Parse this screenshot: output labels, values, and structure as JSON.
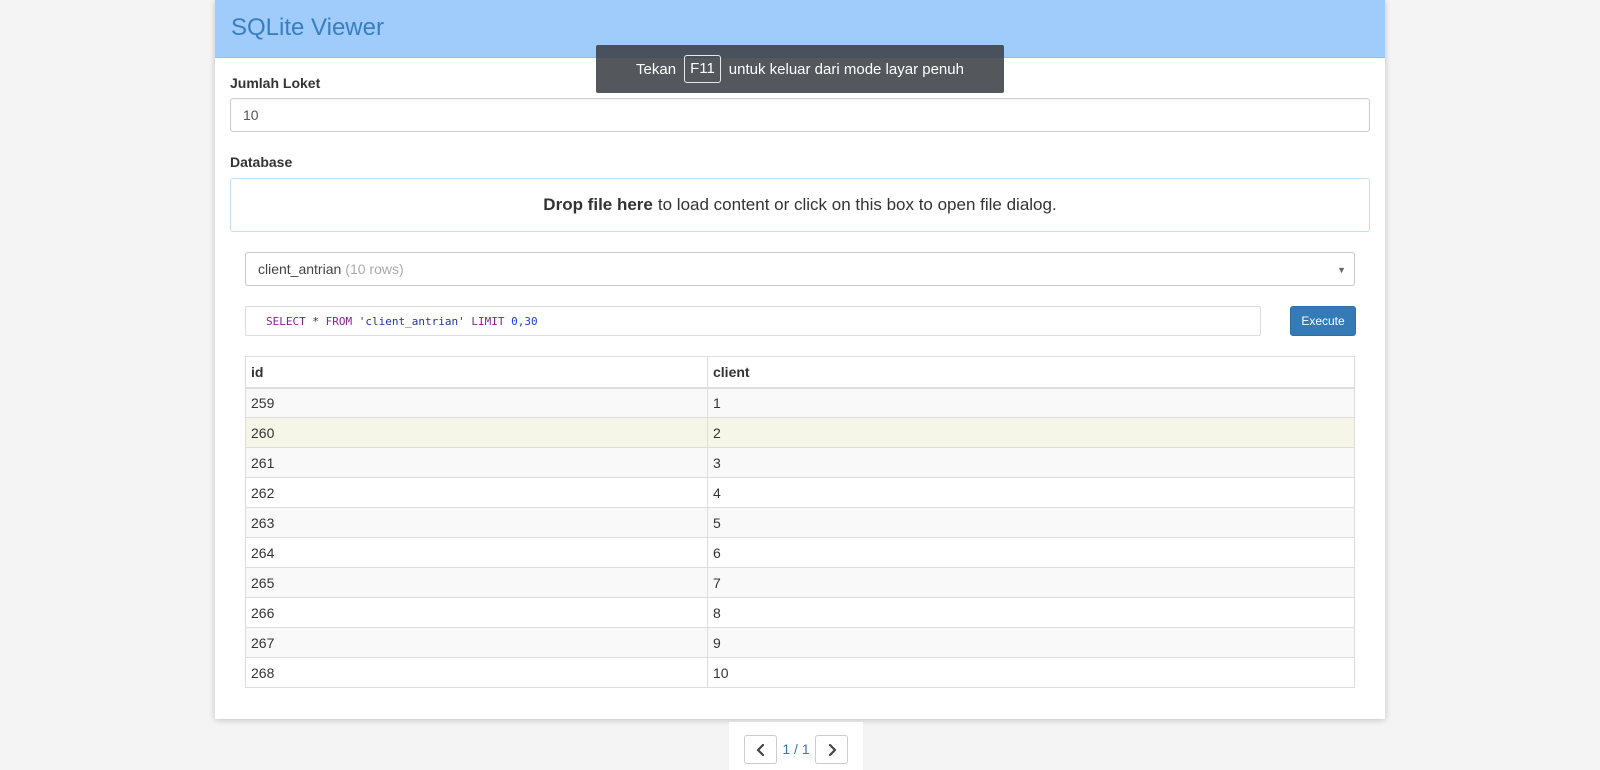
{
  "app": {
    "title": "SQLite Viewer"
  },
  "form": {
    "loket_label": "Jumlah Loket",
    "loket_value": "10",
    "database_label": "Database",
    "dropzone_bold": "Drop file here",
    "dropzone_text": "to load content or click on this box to open file dialog."
  },
  "table_select": {
    "selected": "client_antrian",
    "rows_info": "(10 rows)"
  },
  "query": {
    "kw_select": "SELECT",
    "star": " * ",
    "kw_from": "FROM",
    "table_string": "'client_antrian'",
    "kw_limit": "LIMIT",
    "limit_value": "0,30",
    "execute_label": "Execute"
  },
  "result": {
    "columns": [
      "id",
      "client"
    ],
    "rows": [
      [
        "259",
        "1"
      ],
      [
        "260",
        "2"
      ],
      [
        "261",
        "3"
      ],
      [
        "262",
        "4"
      ],
      [
        "263",
        "5"
      ],
      [
        "264",
        "6"
      ],
      [
        "265",
        "7"
      ],
      [
        "266",
        "8"
      ],
      [
        "267",
        "9"
      ],
      [
        "268",
        "10"
      ]
    ]
  },
  "pagination": {
    "label": "1 / 1"
  },
  "toast": {
    "before": "Tekan",
    "key": "F11",
    "after": "untuk keluar dari mode layar penuh"
  },
  "colors": {
    "header_bg": "#a0ccfb",
    "title_color": "#3a7ec0",
    "primary": "#337ab7"
  }
}
